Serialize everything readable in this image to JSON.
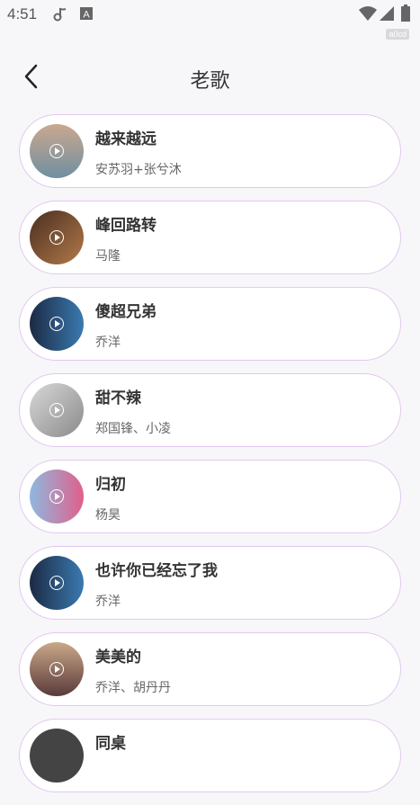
{
  "status": {
    "time": "4:51",
    "device_tag": "a0cd",
    "icons": [
      "music-note-icon",
      "a-badge-icon",
      "wifi-icon",
      "signal-icon",
      "battery-icon"
    ]
  },
  "header": {
    "title": "老歌",
    "back_icon": "chevron-left-icon"
  },
  "songs": [
    {
      "title": "越来越远",
      "artist": "安苏羽+张兮沐",
      "colors": [
        "#caa88f",
        "#6f8fa0"
      ]
    },
    {
      "title": "峰回路转",
      "artist": "马隆",
      "colors": [
        "#4a2e20",
        "#b27a4a"
      ]
    },
    {
      "title": "傻超兄弟",
      "artist": "乔洋",
      "colors": [
        "#1c2a44",
        "#3a7ab0"
      ]
    },
    {
      "title": "甜不辣",
      "artist": "郑国锋、小凌",
      "colors": [
        "#d8d8d8",
        "#8a8a8a"
      ]
    },
    {
      "title": "归初",
      "artist": "杨昊",
      "colors": [
        "#8fb8e0",
        "#e0608a"
      ]
    },
    {
      "title": "也许你已经忘了我",
      "artist": "乔洋",
      "colors": [
        "#1c2a44",
        "#3a7ab0"
      ]
    },
    {
      "title": "美美的",
      "artist": "乔洋、胡丹丹",
      "colors": [
        "#c9a889",
        "#5a3a3a"
      ]
    },
    {
      "title": "同桌",
      "artist": "",
      "colors": [
        "#555555",
        "#333333"
      ]
    }
  ],
  "accent": "#e3c8ef"
}
